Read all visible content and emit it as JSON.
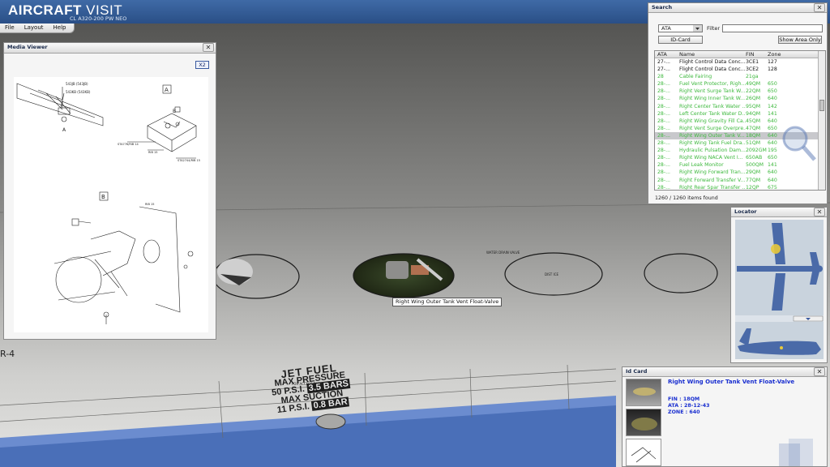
{
  "app": {
    "title_main": "AIRCRAFT",
    "title_sub": " VISIT",
    "subtitle": "CL A320-200 PW NEO"
  },
  "menu": [
    "File",
    "Layout",
    "Help"
  ],
  "media_viewer": {
    "title": "Media Viewer",
    "close": "✕",
    "zoom_label": "X2",
    "callouts": {
      "a": "A",
      "b": "B",
      "c1": "543JB (543JB)",
      "c2": "543KB (543KB)",
      "c3": "STA776/RIB 14",
      "c4": "RIB 15",
      "c5": "STA2744/RIB 15",
      "c6": "RIB 15"
    }
  },
  "search": {
    "title": "Search",
    "close": "✕",
    "ata_value": "ATA",
    "filter_label": "Filter :",
    "filter_value": "",
    "idcard_button": "ID-Card",
    "show_area_button": "Show Area Only",
    "columns": [
      "ATA",
      "Name",
      "FIN",
      "Zone"
    ],
    "rows": [
      {
        "ata": "27-...",
        "name": "Flight Control Data Conc...",
        "fin": "3CE1",
        "zone": "127",
        "green": false,
        "selected": false
      },
      {
        "ata": "27-...",
        "name": "Flight Control Data Conc...",
        "fin": "3CE2",
        "zone": "128",
        "green": false,
        "selected": false
      },
      {
        "ata": "28",
        "name": "Cable Fairing",
        "fin": "21ga",
        "zone": "",
        "green": true,
        "selected": false
      },
      {
        "ata": "28-...",
        "name": "Fuel Vent Protector, Righ...",
        "fin": "49QM",
        "zone": "650",
        "green": true,
        "selected": false
      },
      {
        "ata": "28-...",
        "name": "Right Vent Surge Tank W...",
        "fin": "22QM",
        "zone": "650",
        "green": true,
        "selected": false
      },
      {
        "ata": "28-...",
        "name": "Right Wing Inner Tank W...",
        "fin": "26QM",
        "zone": "640",
        "green": true,
        "selected": false
      },
      {
        "ata": "28-...",
        "name": "Right Center Tank Water ...",
        "fin": "95QM",
        "zone": "142",
        "green": true,
        "selected": false
      },
      {
        "ata": "28-...",
        "name": "Left Center Tank Water D...",
        "fin": "94QM",
        "zone": "141",
        "green": true,
        "selected": false
      },
      {
        "ata": "28-...",
        "name": "Right Wing Gravity Fill Ca...",
        "fin": "45QM",
        "zone": "640",
        "green": true,
        "selected": false
      },
      {
        "ata": "28-...",
        "name": "Right Vent Surge Overpre...",
        "fin": "47QM",
        "zone": "650",
        "green": true,
        "selected": false
      },
      {
        "ata": "28-...",
        "name": "Right Wing Outer Tank V...",
        "fin": "18QM",
        "zone": "640",
        "green": true,
        "selected": true
      },
      {
        "ata": "28-...",
        "name": "Right Wing Tank Fuel Dra...",
        "fin": "51QM",
        "zone": "640",
        "green": true,
        "selected": false
      },
      {
        "ata": "28-...",
        "name": "Hydraulic Pulsation Dam...",
        "fin": "2092GM",
        "zone": "195",
        "green": true,
        "selected": false
      },
      {
        "ata": "28-...",
        "name": "Right Wing NACA Vent I...",
        "fin": "650AB",
        "zone": "650",
        "green": true,
        "selected": false
      },
      {
        "ata": "28-...",
        "name": "Fuel Leak Monitor",
        "fin": "500QM",
        "zone": "141",
        "green": true,
        "selected": false
      },
      {
        "ata": "28-...",
        "name": "Right Wing Forward Tran...",
        "fin": "29QM",
        "zone": "640",
        "green": true,
        "selected": false
      },
      {
        "ata": "28-...",
        "name": "Right Forward Transfer V...",
        "fin": "77QM",
        "zone": "640",
        "green": true,
        "selected": false
      },
      {
        "ata": "28-...",
        "name": "Right Rear Spar Transfer ...",
        "fin": "12QP",
        "zone": "675",
        "green": true,
        "selected": false
      }
    ],
    "count_text": "1260 / 1260 items found",
    "colors": {
      "green": "#3cb83c",
      "black": "#111111",
      "selected_bg": "#c8c8cc"
    }
  },
  "locator": {
    "title": "Locator",
    "close": "✕"
  },
  "id_card": {
    "title": "Id Card",
    "close": "✕",
    "item_name": "Right Wing Outer Tank Vent Float-Valve",
    "fin": "FIN : 18QM",
    "ata": "ATA : 28-12-43",
    "zone": "ZONE : 640"
  },
  "tooltip": "Right Wing Outer Tank Vent Float-Valve",
  "fuel_label": {
    "line1": "JET FUEL",
    "line2": "MAX PRESSURE",
    "line3a": "50 P.S.I.",
    "line3b": "3.5 BARS",
    "line4a": "MAX SUCTION",
    "line5a": "11 P.S.I.",
    "line5b": "0.8 BAR"
  }
}
